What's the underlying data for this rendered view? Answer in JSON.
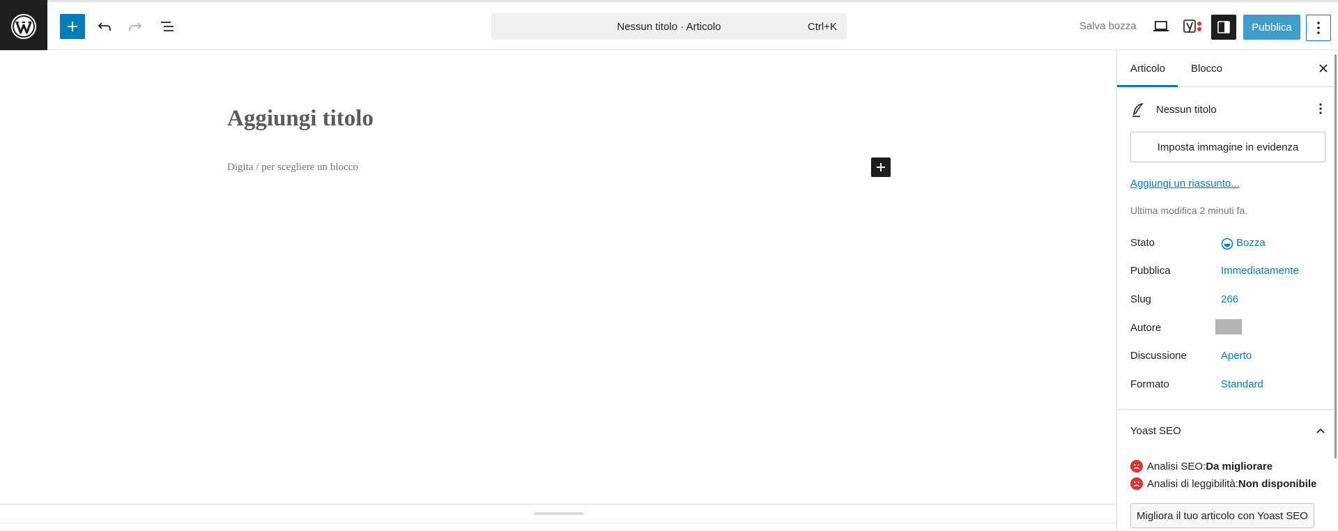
{
  "header": {
    "doc_title": "Nessun titolo · Articolo",
    "shortcut": "Ctrl+K",
    "save_draft": "Salva bozza",
    "publish": "Pubblica"
  },
  "editor": {
    "title_placeholder": "Aggiungi titolo",
    "block_placeholder": "Digita / per scegliere un blocco"
  },
  "sidebar": {
    "tabs": [
      {
        "label": "Articolo"
      },
      {
        "label": "Blocco"
      }
    ],
    "summary_title": "Nessun titolo",
    "featured_image_button": "Imposta immagine in evidenza",
    "excerpt_link": "Aggiungi un riassunto...",
    "last_modified": "Ultima modifica 2 minuti fa.",
    "meta": {
      "stato_label": "Stato",
      "stato_value": "Bozza",
      "pubblica_label": "Pubblica",
      "pubblica_value": "Immediatamente",
      "slug_label": "Slug",
      "slug_value": "266",
      "autore_label": "Autore",
      "discussione_label": "Discussione",
      "discussione_value": "Aperto",
      "formato_label": "Formato",
      "formato_value": "Standard"
    },
    "yoast": {
      "title": "Yoast SEO",
      "seo_label": "Analisi SEO: ",
      "seo_value": "Da migliorare",
      "readability_label": "Analisi di leggibilità: ",
      "readability_value": "Non disponibile",
      "improve_button": "Migliora il tuo articolo con Yoast SEO"
    }
  },
  "colors": {
    "accent": "#007cba",
    "dark": "#1e1e1e",
    "error": "#dc3232"
  }
}
